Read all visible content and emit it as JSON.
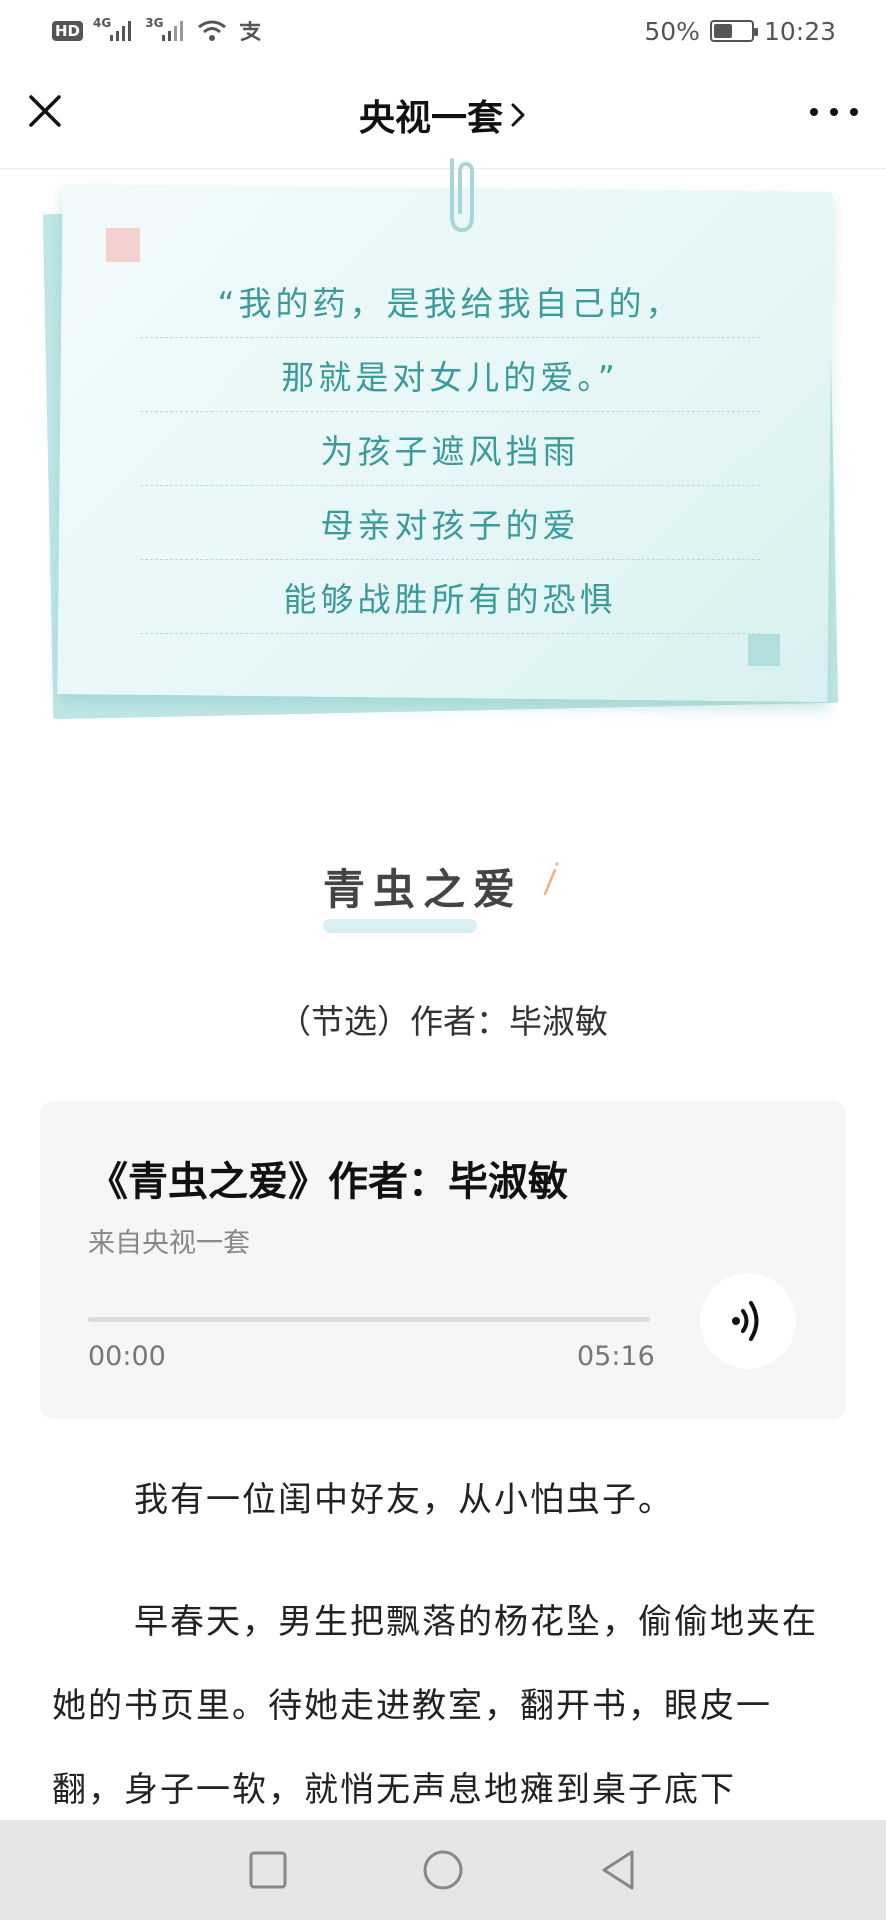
{
  "status_bar": {
    "hd": "HD",
    "net1": "4G",
    "net2": "3G",
    "battery_percent": "50%",
    "battery_level": 0.5,
    "time": "10:23",
    "icons": [
      "hd-icon",
      "signal-icon",
      "signal-icon",
      "wifi-icon",
      "alipay-icon",
      "battery-icon"
    ]
  },
  "nav": {
    "title": "央视一套",
    "chevron": "›",
    "icons": [
      "close-icon",
      "chevron-right-icon",
      "more-icon"
    ]
  },
  "quote": {
    "lines": [
      "“我的药，是我给我自己的，",
      "那就是对女儿的爱。”",
      "为孩子遮风挡雨",
      "母亲对孩子的爱",
      "能够战胜所有的恐惧"
    ],
    "color": "#3b9a9a"
  },
  "article": {
    "title": "青虫之爱",
    "subtitle": "（节选）作者：毕淑敏"
  },
  "audio": {
    "title": "《青虫之爱》作者：毕淑敏",
    "source": "来自央视一套",
    "time_start": "00:00",
    "time_end": "05:16",
    "progress": 0,
    "icons": [
      "audio-play-icon"
    ]
  },
  "body": {
    "paragraphs": [
      "我有一位闺中好友，从小怕虫子。",
      "早春天，男生把飘落的杨花坠，偷偷地夹在她的书页里。待她走进教室，翻开书，眼皮一翻，身子一软，就悄无声息地瘫到桌子底下"
    ]
  },
  "system_nav": {
    "icons": [
      "recent-apps-icon",
      "home-icon",
      "back-icon"
    ]
  }
}
